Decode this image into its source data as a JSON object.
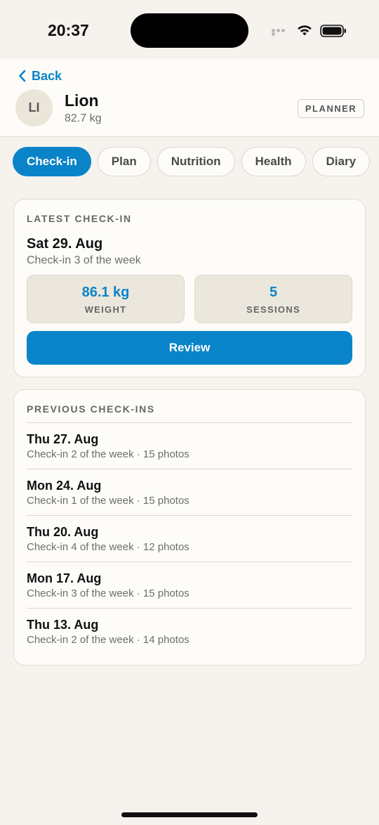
{
  "status_bar": {
    "time": "20:37"
  },
  "header": {
    "back_label": "Back",
    "avatar_initials": "LI",
    "name": "Lion",
    "weight": "82.7 kg",
    "role_badge": "PLANNER"
  },
  "tabs": [
    {
      "label": "Check-in",
      "active": true
    },
    {
      "label": "Plan",
      "active": false
    },
    {
      "label": "Nutrition",
      "active": false
    },
    {
      "label": "Health",
      "active": false
    },
    {
      "label": "Diary",
      "active": false
    }
  ],
  "latest": {
    "section_label": "LATEST CHECK-IN",
    "date": "Sat 29. Aug",
    "subtitle": "Check-in 3 of the week",
    "weight_value": "86.1 kg",
    "weight_label": "WEIGHT",
    "sessions_value": "5",
    "sessions_label": "SESSIONS",
    "review_label": "Review"
  },
  "previous": {
    "section_label": "PREVIOUS CHECK-INS",
    "items": [
      {
        "date": "Thu 27. Aug",
        "meta": "Check-in 2 of the week · 15 photos"
      },
      {
        "date": "Mon 24. Aug",
        "meta": "Check-in 1 of the week · 15 photos"
      },
      {
        "date": "Thu 20. Aug",
        "meta": "Check-in 4 of the week · 12 photos"
      },
      {
        "date": "Mon 17. Aug",
        "meta": "Check-in 3 of the week · 15 photos"
      },
      {
        "date": "Thu 13. Aug",
        "meta": "Check-in 2 of the week · 14 photos"
      }
    ]
  },
  "colors": {
    "accent": "#0a84c9",
    "background": "#f6f3ee",
    "card": "#fdfcf9"
  },
  "icons": {
    "back": "chevron-left-icon",
    "wifi": "wifi-icon",
    "battery": "battery-icon",
    "signal": "signal-dots-icon"
  }
}
